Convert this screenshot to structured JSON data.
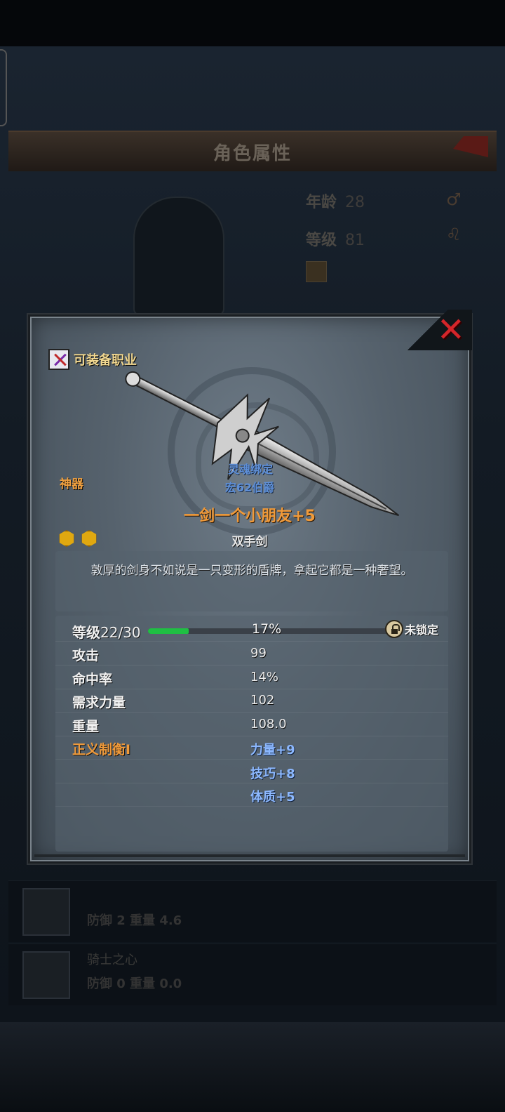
{
  "background": {
    "title": "角色属性",
    "stats": [
      {
        "label": "年龄",
        "value": "28",
        "symbol": "♂"
      },
      {
        "label": "等级",
        "value": "81",
        "symbol": "♌"
      }
    ],
    "list": [
      {
        "name": "",
        "desc": "防御 2 重量 4.6"
      },
      {
        "name": "骑士之心",
        "desc": "防御 0 重量 0.0"
      }
    ]
  },
  "dialog": {
    "class_label": "可装备职业",
    "rarity": "神器",
    "binding": "灵魂绑定",
    "owner": "宏62伯爵",
    "item_name": "一剑一个小朋友+5",
    "weapon_type": "双手剑",
    "gem_count": 2,
    "description": "敦厚的剑身不如说是一只变形的盾牌，拿起它都是一种奢望。",
    "level": {
      "label": "等级",
      "value": "22/30",
      "progress_percent": 17,
      "progress_text": "17%",
      "lock_label": "未锁定"
    },
    "stats": [
      {
        "label": "攻击",
        "value": "99"
      },
      {
        "label": "命中率",
        "value": "14%"
      },
      {
        "label": "需求力量",
        "value": "102"
      },
      {
        "label": "重量",
        "value": "108.0"
      }
    ],
    "enchant": {
      "name": "正义制衡I",
      "bonuses": [
        "力量+9",
        "技巧+8",
        "体质+5"
      ]
    }
  },
  "icons": {
    "close": "close-icon",
    "lock": "unlock-icon",
    "class": "crossed-weapons-icon",
    "gem": "gem-icon"
  },
  "colors": {
    "item_name": "#f09a3a",
    "binding": "#5e8fd8",
    "progress": "#1fbf43",
    "close": "#d4252a"
  }
}
